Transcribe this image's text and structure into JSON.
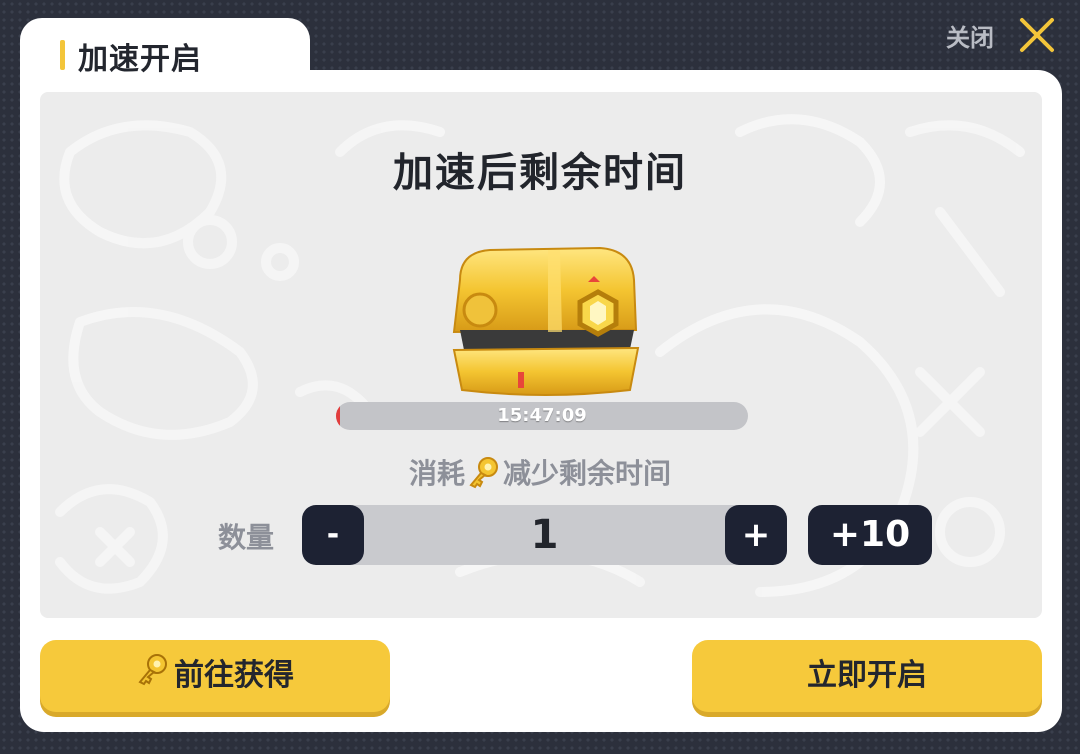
{
  "dialog": {
    "tab_title": "加速开启",
    "close_label": "关闭"
  },
  "panel": {
    "heading": "加速后剩余时间",
    "timer": "15:47:09",
    "timer_progress_percent": 1,
    "consume_prefix": "消耗",
    "consume_suffix": "减少剩余时间"
  },
  "quantity": {
    "label": "数量",
    "minus_label": "-",
    "value": "1",
    "plus_label": "+",
    "plus10_label": "+10"
  },
  "actions": {
    "get_label": "前往获得",
    "open_label": "立即开启"
  },
  "colors": {
    "accent": "#f6c93b",
    "dark_button": "#1d2233",
    "progress_fill": "#e23d3d"
  },
  "icons": {
    "close": "close-x-icon",
    "key": "key-icon",
    "chest": "golden-chest-icon"
  }
}
